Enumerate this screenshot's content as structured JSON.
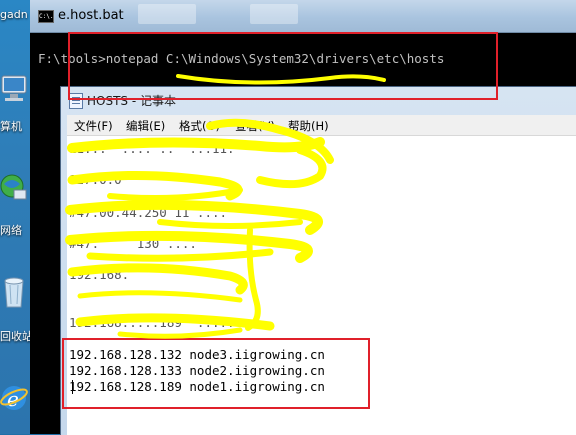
{
  "desktop": {
    "label_top": "gadn",
    "label_computer": "算机",
    "label_network": "网络",
    "label_recycle": "回收站"
  },
  "cmd_window": {
    "title": "e.host.bat",
    "icon_text": "C:\\.",
    "command_line": "F:\\tools>notepad C:\\Windows\\System32\\drivers\\etc\\hosts"
  },
  "notepad": {
    "title": "HOSTS - 记事本",
    "menu": [
      "文件(F)",
      "编辑(E)",
      "格式(O)",
      "查看(V)",
      "帮助(H)"
    ],
    "obscured_lines": [
      "11...  .... ..  ...11.",
      "127.0.0         ",
      "#47.00.44.250 11 ....",
      "#47.     130 ....",
      "192.168.    ",
      "192.168.....189  ....."
    ],
    "host_lines": [
      "192.168.128.132 node3.iigrowing.cn",
      "192.168.128.133 node2.iigrowing.cn",
      "192.168.128.189 node1.iigrowing.cn"
    ]
  },
  "colors": {
    "annotation_box": "#e0202a",
    "scribble": "#ffff00"
  }
}
